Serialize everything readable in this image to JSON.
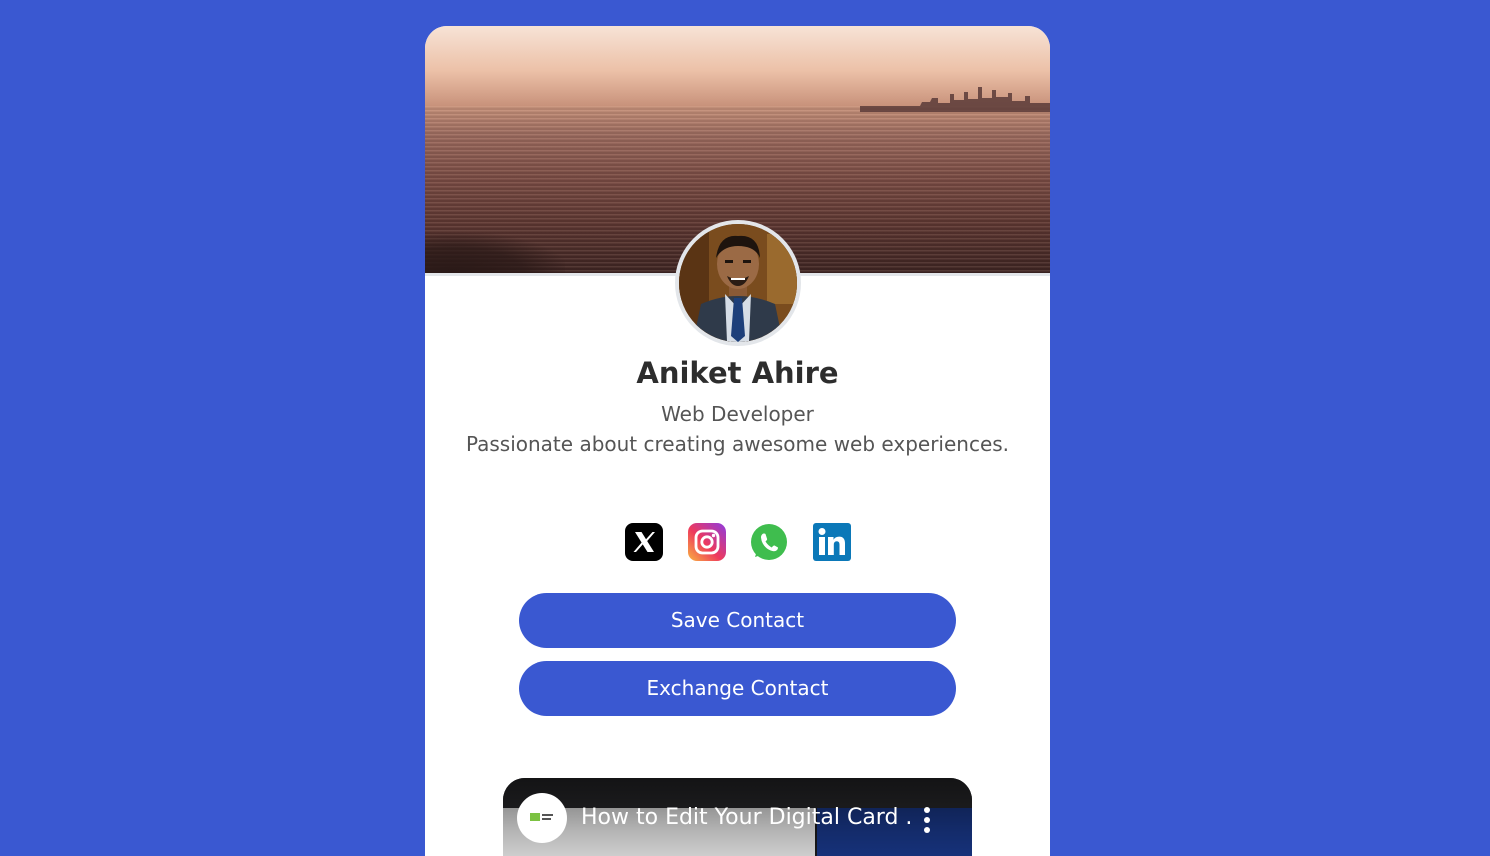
{
  "profile": {
    "name": "Aniket Ahire",
    "role": "Web Developer",
    "bio": "Passionate about creating awesome web experiences."
  },
  "socials": [
    {
      "name": "x",
      "icon": "x-icon"
    },
    {
      "name": "instagram",
      "icon": "instagram-icon"
    },
    {
      "name": "whatsapp",
      "icon": "whatsapp-icon"
    },
    {
      "name": "linkedin",
      "icon": "linkedin-icon"
    }
  ],
  "buttons": {
    "save_label": "Save Contact",
    "exchange_label": "Exchange Contact"
  },
  "video": {
    "title": "How to Edit Your Digital Card ..."
  },
  "colors": {
    "background": "#3a58d1",
    "accent": "#3a58d1",
    "card": "#ffffff"
  }
}
